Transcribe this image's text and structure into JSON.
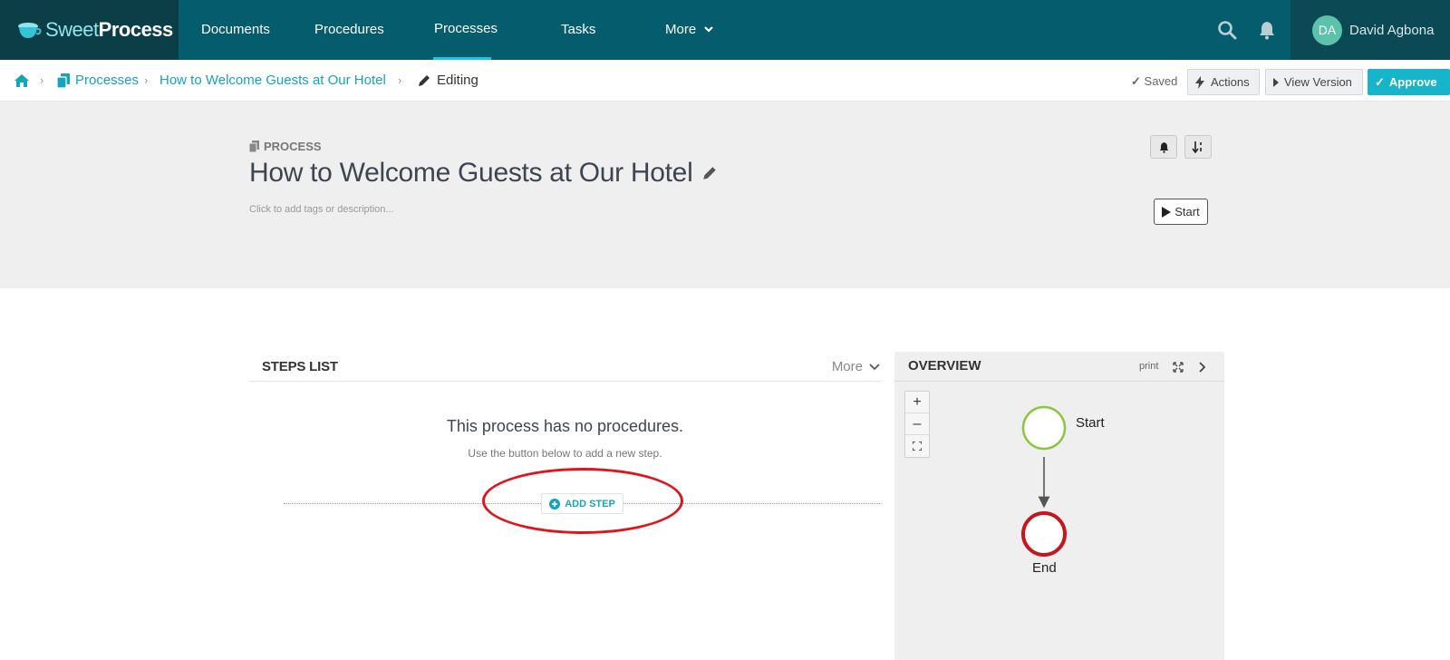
{
  "app": {
    "logo_light": "Sweet",
    "logo_bold": "Process"
  },
  "nav": {
    "items": [
      {
        "label": "Documents"
      },
      {
        "label": "Procedures"
      },
      {
        "label": "Processes",
        "active": true
      },
      {
        "label": "Tasks"
      },
      {
        "label": "More"
      }
    ],
    "icons": [
      "search-icon",
      "bell-icon",
      "chevron-down-icon"
    ],
    "user": {
      "initials": "DA",
      "name": "David Agbona"
    }
  },
  "breadcrumb": {
    "items": [
      "Processes",
      "How to Welcome Guests at Our Hotel",
      "Editing"
    ]
  },
  "toolbar": {
    "saved": "Saved",
    "actions": "Actions",
    "view_version": "View Version",
    "approve": "Approve"
  },
  "process": {
    "label": "PROCESS",
    "title": "How to Welcome Guests at Our Hotel",
    "description_placeholder": "Click to add tags or description...",
    "start": "Start"
  },
  "steps": {
    "title": "STEPS LIST",
    "more": "More",
    "empty_title": "This process has no procedures.",
    "empty_sub": "Use the button below to add a new step.",
    "add_step": "ADD STEP"
  },
  "overview": {
    "title": "OVERVIEW",
    "print": "print",
    "zoom_in": "+",
    "zoom_out": "–",
    "start_node": "Start",
    "end_node": "End"
  },
  "colors": {
    "nav_bg": "#055c6c",
    "accent": "#17b5cc",
    "start_node": "#8cc63f",
    "end_node": "#c8141c",
    "highlight": "#e0141c"
  }
}
